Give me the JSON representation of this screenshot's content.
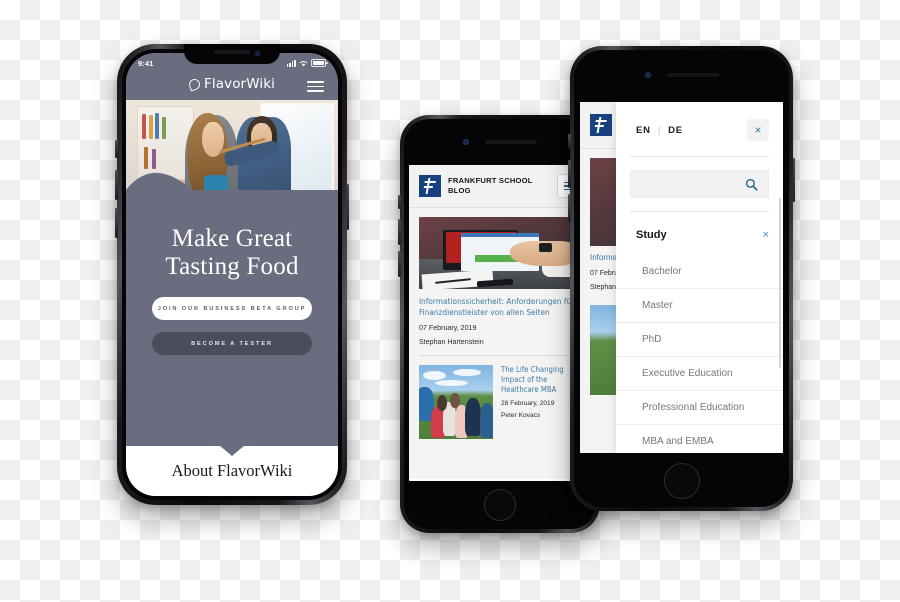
{
  "scene": {
    "title": "Three smartphone mockups showing responsive mobile websites"
  },
  "phone1": {
    "device": "iPhone X style",
    "status_bar": {
      "time": "9:41",
      "signal_icon": "cellular-bars-icon",
      "wifi_icon": "wifi-icon",
      "battery_icon": "battery-full-icon"
    },
    "header": {
      "logo_text": "FlavorWiki",
      "logo_mark": "leaf-icon",
      "menu_icon": "hamburger-menu-icon"
    },
    "hero": {
      "image_alt": "Couple cooking in a kitchen, woman tasting from wooden spoon"
    },
    "headline_line1": "Make Great",
    "headline_line2": "Tasting Food",
    "buttons": [
      {
        "label": "JOIN OUR BUSINESS BETA GROUP",
        "style": "primary-light"
      },
      {
        "label": "BECOME A TESTER",
        "style": "secondary-dark"
      }
    ],
    "footer_link": "About FlavorWiki",
    "colors": {
      "brand": "#6a6c80",
      "button_dark": "#4b4d5d",
      "text_on_brand": "#ffffff"
    }
  },
  "phone2": {
    "device": "iPhone 8 style",
    "header": {
      "brand_line1": "FRANKFURT SCHOOL",
      "brand_line2": "BLOG",
      "logo_icon": "frankfurt-school-logo-icon",
      "menu_icon": "hamburger-menu-icon"
    },
    "featured_post": {
      "image_alt": "Hands typing on a laptop with red screen on a desk",
      "title": "Informationssicherheit: Anforderungen für Finanzdienstleister von allen Seiten",
      "date": "07 February, 2019",
      "author": "Stephan Hartenstein"
    },
    "posts": [
      {
        "image_alt": "Group of students sitting on grass outdoors",
        "title": "The Life Changing Impact of the Healthcare MBA",
        "date": "28 February, 2019",
        "author": "Peter Kovacs"
      }
    ],
    "colors": {
      "link": "#3f7ba6",
      "logo": "#17427e",
      "header_bg": "#f2f2f2"
    }
  },
  "phone3": {
    "device": "iPhone 8 Plus style",
    "menu": {
      "languages": [
        "EN",
        "DE"
      ],
      "language_separator": "|",
      "close_label": "×",
      "close_icon": "close-icon",
      "search": {
        "placeholder": "",
        "value": "",
        "icon": "search-icon"
      },
      "section": {
        "title": "Study",
        "collapse_label": "×",
        "collapse_icon": "close-icon"
      },
      "items": [
        "Bachelor",
        "Master",
        "PhD",
        "Executive Education",
        "Professional Education",
        "MBA and EMBA"
      ]
    },
    "colors": {
      "accent": "#3f7ba6",
      "item_text": "#77777c",
      "panel_bg": "#ffffff"
    }
  }
}
